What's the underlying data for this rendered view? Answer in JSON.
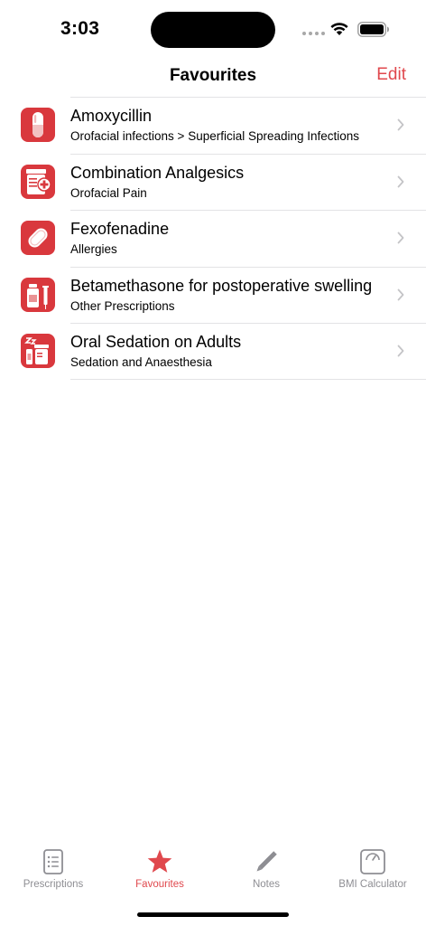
{
  "status_bar": {
    "time": "3:03"
  },
  "nav": {
    "title": "Favourites",
    "edit_label": "Edit"
  },
  "colors": {
    "accent": "#e0484d",
    "icon_background": "#d9383d",
    "inactive_tab": "#8e8e93"
  },
  "favourites": [
    {
      "title": "Amoxycillin",
      "subtitle": "Orofacial infections > Superficial Spreading Infections",
      "icon": "capsule-icon"
    },
    {
      "title": "Combination Analgesics",
      "subtitle": "Orofacial Pain",
      "icon": "pill-bottle-icon"
    },
    {
      "title": "Fexofenadine",
      "subtitle": "Allergies",
      "icon": "tablet-icon"
    },
    {
      "title": "Betamethasone for postoperative swelling",
      "subtitle": "Other Prescriptions",
      "icon": "vial-syringe-icon"
    },
    {
      "title": "Oral Sedation on Adults",
      "subtitle": "Sedation and Anaesthesia",
      "icon": "sleep-bottle-icon"
    }
  ],
  "tabs": [
    {
      "label": "Prescriptions",
      "icon": "list-document-icon",
      "active": false
    },
    {
      "label": "Favourites",
      "icon": "star-icon",
      "active": true
    },
    {
      "label": "Notes",
      "icon": "pencil-icon",
      "active": false
    },
    {
      "label": "BMI Calculator",
      "icon": "scale-icon",
      "active": false
    }
  ]
}
